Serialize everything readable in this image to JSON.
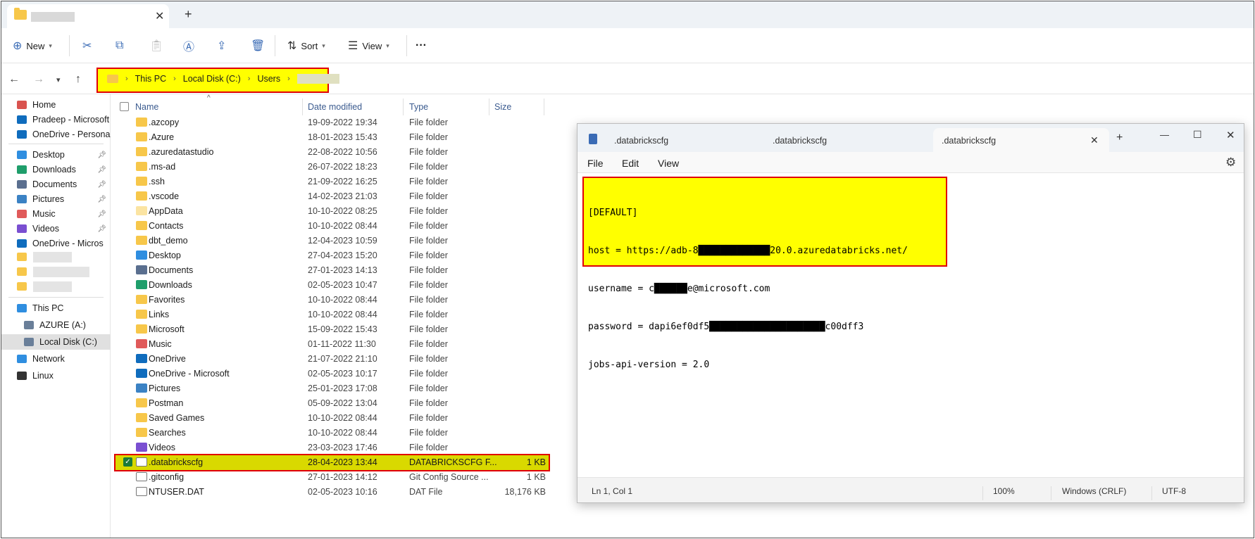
{
  "explorer": {
    "title_bar": {
      "close_tab": "✕",
      "new_tab": "+"
    },
    "command_bar": {
      "new_label": "New",
      "sort_label": "Sort",
      "view_label": "View",
      "more": "···"
    },
    "address_bar": {
      "crumbs": [
        "This PC",
        "Local Disk (C:)",
        "Users"
      ],
      "separator": "›"
    },
    "nav_pane": {
      "quick": [
        {
          "label": "Home",
          "icon": "home-icon",
          "color": "#d9534f"
        },
        {
          "label": "Pradeep - Microsoft",
          "icon": "onedrive-icon",
          "color": "#0f6cbd"
        },
        {
          "label": "OneDrive - Personal",
          "icon": "onedrive-icon",
          "color": "#0f6cbd"
        }
      ],
      "pinned": [
        {
          "label": "Desktop",
          "icon": "desktop-icon",
          "color": "#2f8ee0"
        },
        {
          "label": "Downloads",
          "icon": "downloads-icon",
          "color": "#1f9e6b"
        },
        {
          "label": "Documents",
          "icon": "documents-icon",
          "color": "#5a6f8f"
        },
        {
          "label": "Pictures",
          "icon": "pictures-icon",
          "color": "#3b82c4"
        },
        {
          "label": "Music",
          "icon": "music-icon",
          "color": "#e05a5a"
        },
        {
          "label": "Videos",
          "icon": "videos-icon",
          "color": "#7a4fd1"
        },
        {
          "label": "OneDrive - Micros",
          "icon": "onedrive-icon",
          "color": "#0f6cbd"
        }
      ],
      "computer": [
        {
          "label": "This PC",
          "icon": "pc-icon",
          "color": "#2f8ee0"
        },
        {
          "label": "AZURE (A:)",
          "icon": "network-drive-icon",
          "color": "#6a7f99"
        },
        {
          "label": "Local Disk (C:)",
          "icon": "disk-icon",
          "color": "#6a7f99",
          "selected": true
        },
        {
          "label": "Network",
          "icon": "network-icon",
          "color": "#2f8ee0"
        },
        {
          "label": "Linux",
          "icon": "linux-icon",
          "color": "#333333"
        }
      ]
    },
    "columns": {
      "name": "Name",
      "date": "Date modified",
      "type": "Type",
      "size": "Size"
    },
    "files": [
      {
        "name": ".azcopy",
        "date": "19-09-2022 19:34",
        "type": "File folder",
        "size": "",
        "icon": "folder-icon",
        "color": "#f7c74a"
      },
      {
        "name": ".Azure",
        "date": "18-01-2023 15:43",
        "type": "File folder",
        "size": "",
        "icon": "folder-icon",
        "color": "#f7c74a"
      },
      {
        "name": ".azuredatastudio",
        "date": "22-08-2022 10:56",
        "type": "File folder",
        "size": "",
        "icon": "folder-icon",
        "color": "#f7c74a"
      },
      {
        "name": ".ms-ad",
        "date": "26-07-2022 18:23",
        "type": "File folder",
        "size": "",
        "icon": "folder-icon",
        "color": "#f7c74a"
      },
      {
        "name": ".ssh",
        "date": "21-09-2022 16:25",
        "type": "File folder",
        "size": "",
        "icon": "folder-icon",
        "color": "#f7c74a"
      },
      {
        "name": ".vscode",
        "date": "14-02-2023 21:03",
        "type": "File folder",
        "size": "",
        "icon": "folder-icon",
        "color": "#f7c74a"
      },
      {
        "name": "AppData",
        "date": "10-10-2022 08:25",
        "type": "File folder",
        "size": "",
        "icon": "folder-icon",
        "color": "#fbe4a2"
      },
      {
        "name": "Contacts",
        "date": "10-10-2022 08:44",
        "type": "File folder",
        "size": "",
        "icon": "folder-icon",
        "color": "#f7c74a"
      },
      {
        "name": "dbt_demo",
        "date": "12-04-2023 10:59",
        "type": "File folder",
        "size": "",
        "icon": "folder-icon",
        "color": "#f7c74a"
      },
      {
        "name": "Desktop",
        "date": "27-04-2023 15:20",
        "type": "File folder",
        "size": "",
        "icon": "desktop-icon",
        "color": "#2f8ee0"
      },
      {
        "name": "Documents",
        "date": "27-01-2023 14:13",
        "type": "File folder",
        "size": "",
        "icon": "documents-icon",
        "color": "#5a6f8f"
      },
      {
        "name": "Downloads",
        "date": "02-05-2023 10:47",
        "type": "File folder",
        "size": "",
        "icon": "downloads-icon",
        "color": "#1f9e6b"
      },
      {
        "name": "Favorites",
        "date": "10-10-2022 08:44",
        "type": "File folder",
        "size": "",
        "icon": "folder-icon",
        "color": "#f7c74a"
      },
      {
        "name": "Links",
        "date": "10-10-2022 08:44",
        "type": "File folder",
        "size": "",
        "icon": "folder-icon",
        "color": "#f7c74a"
      },
      {
        "name": "Microsoft",
        "date": "15-09-2022 15:43",
        "type": "File folder",
        "size": "",
        "icon": "folder-icon",
        "color": "#f7c74a"
      },
      {
        "name": "Music",
        "date": "01-11-2022 11:30",
        "type": "File folder",
        "size": "",
        "icon": "music-icon",
        "color": "#e05a5a"
      },
      {
        "name": "OneDrive",
        "date": "21-07-2022 21:10",
        "type": "File folder",
        "size": "",
        "icon": "onedrive-icon",
        "color": "#0f6cbd"
      },
      {
        "name": "OneDrive - Microsoft",
        "date": "02-05-2023 10:17",
        "type": "File folder",
        "size": "",
        "icon": "onedrive-icon",
        "color": "#0f6cbd"
      },
      {
        "name": "Pictures",
        "date": "25-01-2023 17:08",
        "type": "File folder",
        "size": "",
        "icon": "pictures-icon",
        "color": "#3b82c4"
      },
      {
        "name": "Postman",
        "date": "05-09-2022 13:04",
        "type": "File folder",
        "size": "",
        "icon": "folder-icon",
        "color": "#f7c74a"
      },
      {
        "name": "Saved Games",
        "date": "10-10-2022 08:44",
        "type": "File folder",
        "size": "",
        "icon": "folder-icon",
        "color": "#f7c74a"
      },
      {
        "name": "Searches",
        "date": "10-10-2022 08:44",
        "type": "File folder",
        "size": "",
        "icon": "folder-icon",
        "color": "#f7c74a"
      },
      {
        "name": "Videos",
        "date": "23-03-2023 17:46",
        "type": "File folder",
        "size": "",
        "icon": "videos-icon",
        "color": "#7a4fd1"
      },
      {
        "name": ".databrickscfg",
        "date": "28-04-2023 13:44",
        "type": "DATABRICKSCFG F...",
        "size": "1 KB",
        "icon": "file-icon",
        "color": "#ffffff",
        "selected": true
      },
      {
        "name": ".gitconfig",
        "date": "27-01-2023 14:12",
        "type": "Git Config Source ...",
        "size": "1 KB",
        "icon": "file-icon",
        "color": "#ffffff"
      },
      {
        "name": "NTUSER.DAT",
        "date": "02-05-2023 10:16",
        "type": "DAT File",
        "size": "18,176 KB",
        "icon": "file-icon",
        "color": "#ffffff"
      }
    ]
  },
  "notepad": {
    "tabs": [
      ".databrickscfg",
      ".databrickscfg",
      ".databrickscfg"
    ],
    "tab_close": "✕",
    "new_tab": "+",
    "window_buttons": {
      "minimize": "—",
      "maximize": "☐",
      "close": "✕"
    },
    "menus": [
      "File",
      "Edit",
      "View"
    ],
    "lines": [
      "[DEFAULT]",
      "host = https://adb-8█████████████20.0.azuredatabricks.net/",
      "username = c██████e@microsoft.com",
      "password = dapi6ef0df5█████████████████████c00dff3",
      "jobs-api-version = 2.0"
    ],
    "status": {
      "position": "Ln 1, Col 1",
      "zoom": "100%",
      "line_ending": "Windows (CRLF)",
      "encoding": "UTF-8"
    },
    "highlight_color": "#ffff00"
  }
}
